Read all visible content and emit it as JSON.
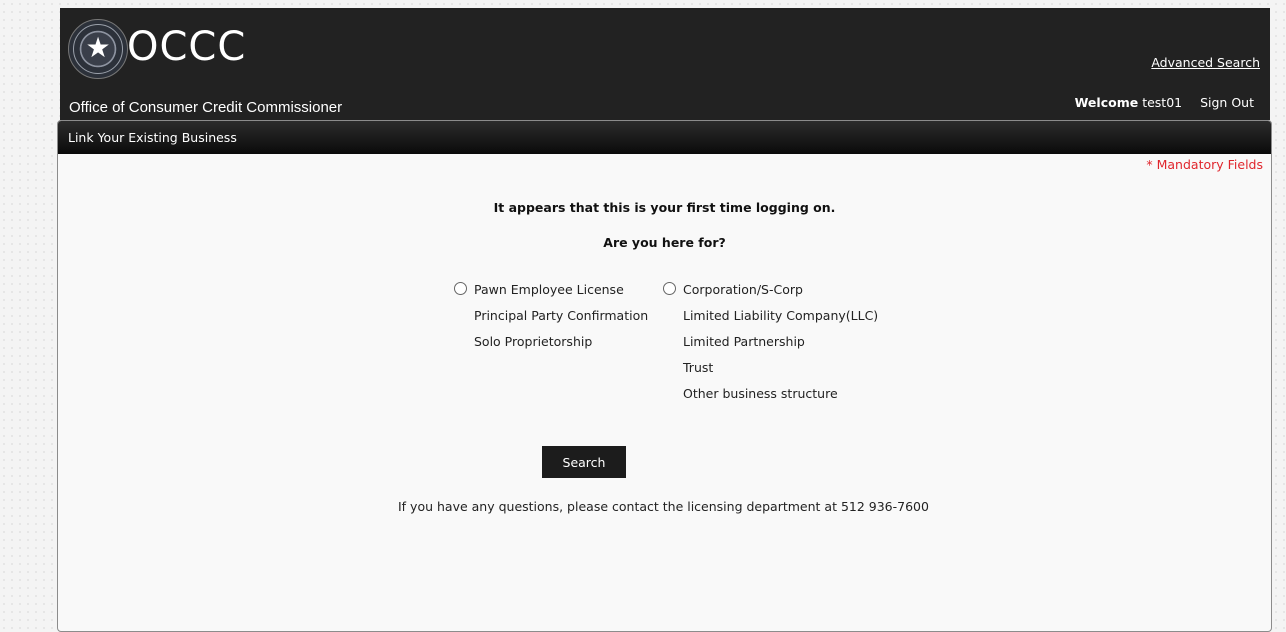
{
  "header": {
    "brand": "OCCC",
    "subtitle": "Office of Consumer Credit Commissioner",
    "advanced_search": "Advanced Search",
    "welcome_label": "Welcome",
    "username": "test01",
    "sign_out": "Sign Out",
    "background_color": "#222222"
  },
  "panel": {
    "title": "Link Your Existing Business",
    "mandatory_note": "* Mandatory Fields",
    "intro_line1": "It appears that this is your first time logging on.",
    "intro_line2": "Are you here for?",
    "left_option": {
      "label": "Pawn Employee License",
      "items": [
        "Principal Party Confirmation",
        "Solo Proprietorship"
      ]
    },
    "right_option": {
      "label": "Corporation/S-Corp",
      "items": [
        "Limited Liability Company(LLC)",
        "Limited Partnership",
        "Trust",
        "Other business structure"
      ]
    },
    "search_button": "Search",
    "contact_text": "If you have any questions, please contact the licensing department at 512 936-7600"
  },
  "colors": {
    "mandatory": "#e0262d",
    "button": "#1c1c1c"
  }
}
